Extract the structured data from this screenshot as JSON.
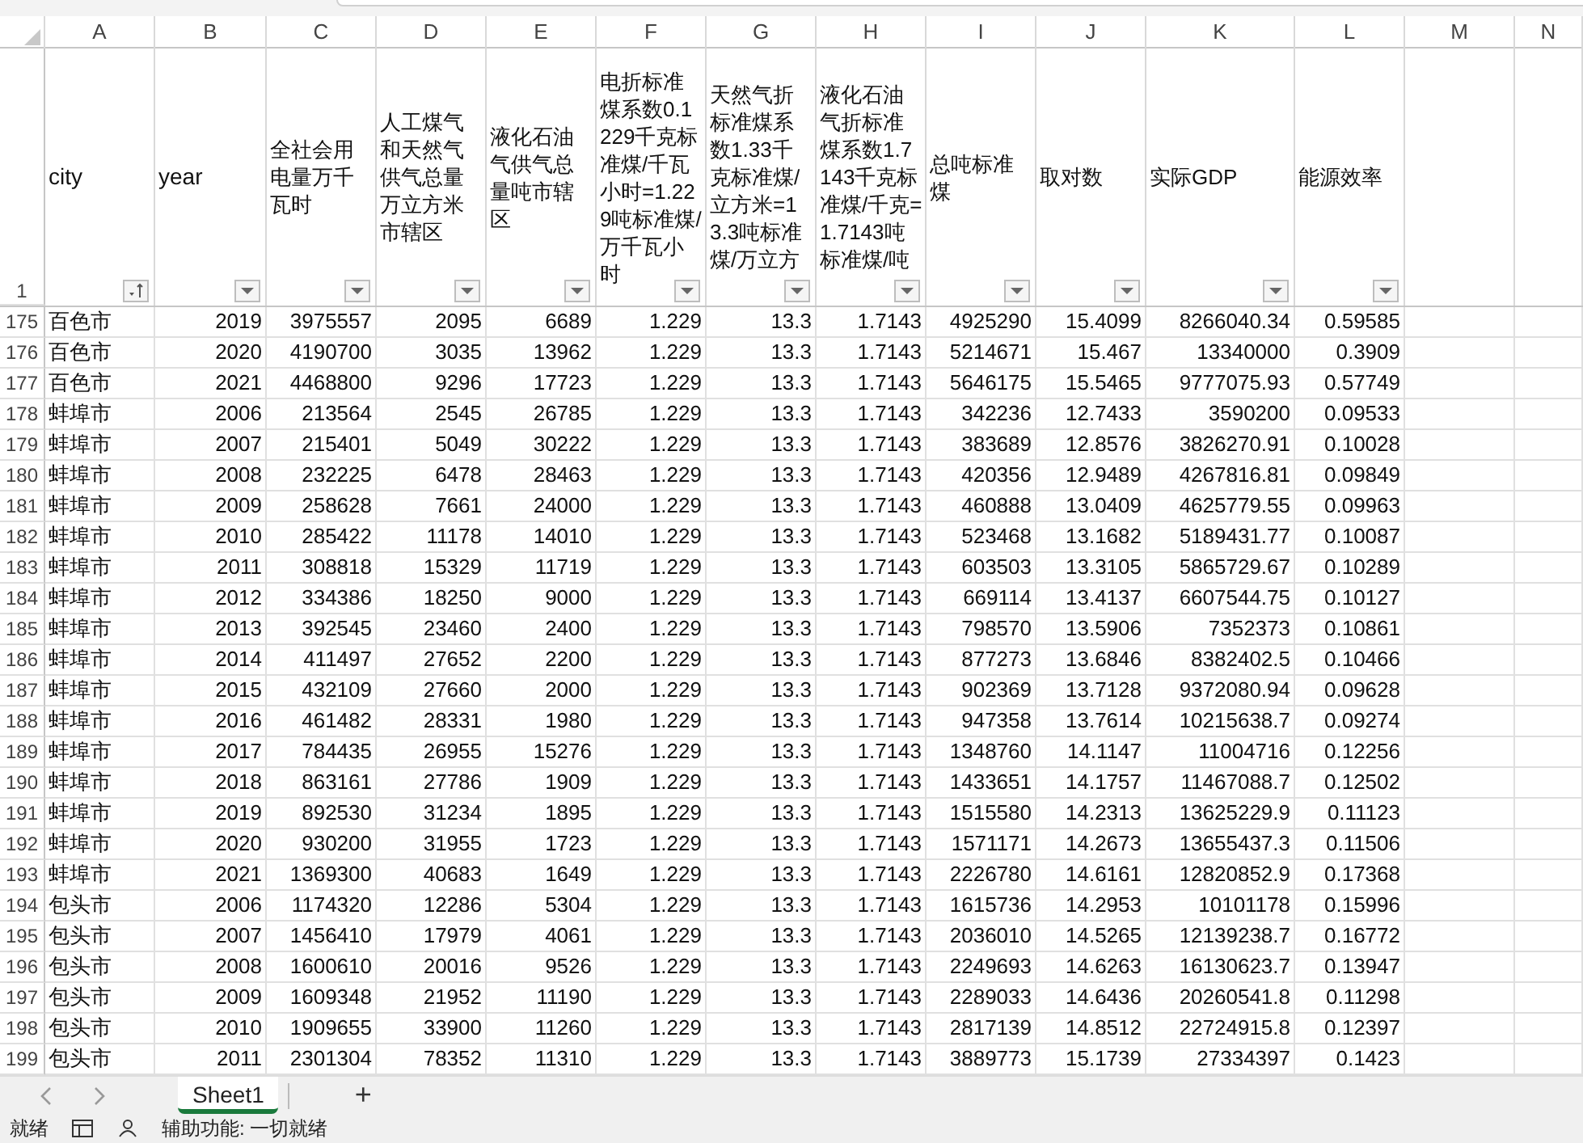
{
  "columns": [
    {
      "letter": "A",
      "header": "city",
      "kind": "text",
      "has_filter": true,
      "sorted": true
    },
    {
      "letter": "B",
      "header": "year",
      "kind": "number",
      "has_filter": true,
      "sorted": false
    },
    {
      "letter": "C",
      "header": "全社会用电量万千瓦时",
      "kind": "number",
      "has_filter": true,
      "sorted": false
    },
    {
      "letter": "D",
      "header": "人工煤气和天然气供气总量万立方米市辖区",
      "kind": "number",
      "has_filter": true,
      "sorted": false
    },
    {
      "letter": "E",
      "header": "液化石油气供气总量吨市辖区",
      "kind": "number",
      "has_filter": true,
      "sorted": false
    },
    {
      "letter": "F",
      "header": "电折标准煤系数0.1229千克标准煤/千瓦小时=1.229吨标准煤/万千瓦小时",
      "kind": "number",
      "has_filter": true,
      "sorted": false
    },
    {
      "letter": "G",
      "header": "天然气折标准煤系数1.33千克标准煤/立方米=13.3吨标准煤/万立方",
      "kind": "number",
      "has_filter": true,
      "sorted": false
    },
    {
      "letter": "H",
      "header": "液化石油气折标准煤系数1.7143千克标准煤/千克=1.7143吨标准煤/吨",
      "kind": "number",
      "has_filter": true,
      "sorted": false
    },
    {
      "letter": "I",
      "header": "总吨标准煤",
      "kind": "number",
      "has_filter": true,
      "sorted": false
    },
    {
      "letter": "J",
      "header": "取对数",
      "kind": "number",
      "has_filter": true,
      "sorted": false
    },
    {
      "letter": "K",
      "header": "实际GDP",
      "kind": "number",
      "has_filter": true,
      "sorted": false
    },
    {
      "letter": "L",
      "header": "能源效率",
      "kind": "number",
      "has_filter": true,
      "sorted": false
    },
    {
      "letter": "M",
      "has_filter": false
    },
    {
      "letter": "N",
      "has_filter": false
    }
  ],
  "header_row_number": "1",
  "rows": [
    {
      "number": "175",
      "cells": [
        "百色市",
        "2019",
        "3975557",
        "2095",
        "6689",
        "1.229",
        "13.3",
        "1.7143",
        "4925290",
        "15.4099",
        "8266040.34",
        "0.59585"
      ]
    },
    {
      "number": "176",
      "cells": [
        "百色市",
        "2020",
        "4190700",
        "3035",
        "13962",
        "1.229",
        "13.3",
        "1.7143",
        "5214671",
        "15.467",
        "13340000",
        "0.3909"
      ]
    },
    {
      "number": "177",
      "cells": [
        "百色市",
        "2021",
        "4468800",
        "9296",
        "17723",
        "1.229",
        "13.3",
        "1.7143",
        "5646175",
        "15.5465",
        "9777075.93",
        "0.57749"
      ]
    },
    {
      "number": "178",
      "cells": [
        "蚌埠市",
        "2006",
        "213564",
        "2545",
        "26785",
        "1.229",
        "13.3",
        "1.7143",
        "342236",
        "12.7433",
        "3590200",
        "0.09533"
      ]
    },
    {
      "number": "179",
      "cells": [
        "蚌埠市",
        "2007",
        "215401",
        "5049",
        "30222",
        "1.229",
        "13.3",
        "1.7143",
        "383689",
        "12.8576",
        "3826270.91",
        "0.10028"
      ]
    },
    {
      "number": "180",
      "cells": [
        "蚌埠市",
        "2008",
        "232225",
        "6478",
        "28463",
        "1.229",
        "13.3",
        "1.7143",
        "420356",
        "12.9489",
        "4267816.81",
        "0.09849"
      ]
    },
    {
      "number": "181",
      "cells": [
        "蚌埠市",
        "2009",
        "258628",
        "7661",
        "24000",
        "1.229",
        "13.3",
        "1.7143",
        "460888",
        "13.0409",
        "4625779.55",
        "0.09963"
      ]
    },
    {
      "number": "182",
      "cells": [
        "蚌埠市",
        "2010",
        "285422",
        "11178",
        "14010",
        "1.229",
        "13.3",
        "1.7143",
        "523468",
        "13.1682",
        "5189431.77",
        "0.10087"
      ]
    },
    {
      "number": "183",
      "cells": [
        "蚌埠市",
        "2011",
        "308818",
        "15329",
        "11719",
        "1.229",
        "13.3",
        "1.7143",
        "603503",
        "13.3105",
        "5865729.67",
        "0.10289"
      ]
    },
    {
      "number": "184",
      "cells": [
        "蚌埠市",
        "2012",
        "334386",
        "18250",
        "9000",
        "1.229",
        "13.3",
        "1.7143",
        "669114",
        "13.4137",
        "6607544.75",
        "0.10127"
      ]
    },
    {
      "number": "185",
      "cells": [
        "蚌埠市",
        "2013",
        "392545",
        "23460",
        "2400",
        "1.229",
        "13.3",
        "1.7143",
        "798570",
        "13.5906",
        "7352373",
        "0.10861"
      ]
    },
    {
      "number": "186",
      "cells": [
        "蚌埠市",
        "2014",
        "411497",
        "27652",
        "2200",
        "1.229",
        "13.3",
        "1.7143",
        "877273",
        "13.6846",
        "8382402.5",
        "0.10466"
      ]
    },
    {
      "number": "187",
      "cells": [
        "蚌埠市",
        "2015",
        "432109",
        "27660",
        "2000",
        "1.229",
        "13.3",
        "1.7143",
        "902369",
        "13.7128",
        "9372080.94",
        "0.09628"
      ]
    },
    {
      "number": "188",
      "cells": [
        "蚌埠市",
        "2016",
        "461482",
        "28331",
        "1980",
        "1.229",
        "13.3",
        "1.7143",
        "947358",
        "13.7614",
        "10215638.7",
        "0.09274"
      ]
    },
    {
      "number": "189",
      "cells": [
        "蚌埠市",
        "2017",
        "784435",
        "26955",
        "15276",
        "1.229",
        "13.3",
        "1.7143",
        "1348760",
        "14.1147",
        "11004716",
        "0.12256"
      ]
    },
    {
      "number": "190",
      "cells": [
        "蚌埠市",
        "2018",
        "863161",
        "27786",
        "1909",
        "1.229",
        "13.3",
        "1.7143",
        "1433651",
        "14.1757",
        "11467088.7",
        "0.12502"
      ]
    },
    {
      "number": "191",
      "cells": [
        "蚌埠市",
        "2019",
        "892530",
        "31234",
        "1895",
        "1.229",
        "13.3",
        "1.7143",
        "1515580",
        "14.2313",
        "13625229.9",
        "0.11123"
      ]
    },
    {
      "number": "192",
      "cells": [
        "蚌埠市",
        "2020",
        "930200",
        "31955",
        "1723",
        "1.229",
        "13.3",
        "1.7143",
        "1571171",
        "14.2673",
        "13655437.3",
        "0.11506"
      ]
    },
    {
      "number": "193",
      "cells": [
        "蚌埠市",
        "2021",
        "1369300",
        "40683",
        "1649",
        "1.229",
        "13.3",
        "1.7143",
        "2226780",
        "14.6161",
        "12820852.9",
        "0.17368"
      ]
    },
    {
      "number": "194",
      "cells": [
        "包头市",
        "2006",
        "1174320",
        "12286",
        "5304",
        "1.229",
        "13.3",
        "1.7143",
        "1615736",
        "14.2953",
        "10101178",
        "0.15996"
      ]
    },
    {
      "number": "195",
      "cells": [
        "包头市",
        "2007",
        "1456410",
        "17979",
        "4061",
        "1.229",
        "13.3",
        "1.7143",
        "2036010",
        "14.5265",
        "12139238.7",
        "0.16772"
      ]
    },
    {
      "number": "196",
      "cells": [
        "包头市",
        "2008",
        "1600610",
        "20016",
        "9526",
        "1.229",
        "13.3",
        "1.7143",
        "2249693",
        "14.6263",
        "16130623.7",
        "0.13947"
      ]
    },
    {
      "number": "197",
      "cells": [
        "包头市",
        "2009",
        "1609348",
        "21952",
        "11190",
        "1.229",
        "13.3",
        "1.7143",
        "2289033",
        "14.6436",
        "20260541.8",
        "0.11298"
      ]
    },
    {
      "number": "198",
      "cells": [
        "包头市",
        "2010",
        "1909655",
        "33900",
        "11260",
        "1.229",
        "13.3",
        "1.7143",
        "2817139",
        "14.8512",
        "22724915.8",
        "0.12397"
      ]
    },
    {
      "number": "199",
      "cells": [
        "包头市",
        "2011",
        "2301304",
        "78352",
        "11310",
        "1.229",
        "13.3",
        "1.7143",
        "3889773",
        "15.1739",
        "27334397",
        "0.1423"
      ]
    }
  ],
  "sheet_tabs": [
    {
      "label": "Sheet1",
      "selected": true
    }
  ],
  "add_sheet": "+",
  "status_bar": {
    "ready": "就绪",
    "accessibility": "辅助功能: 一切就绪"
  }
}
